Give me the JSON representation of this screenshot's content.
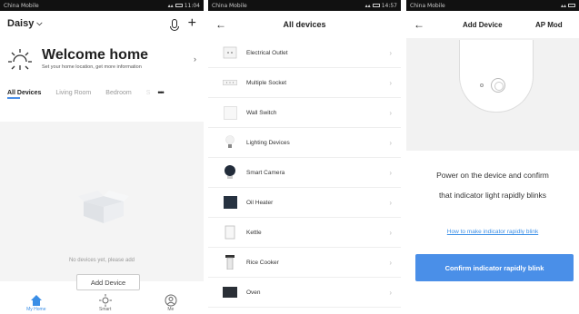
{
  "screen1": {
    "status": {
      "carrier": "China Mobile",
      "time": "11:04"
    },
    "home_name": "Daisy",
    "welcome_title": "Welcome home",
    "welcome_sub": "Set your home location, get more information",
    "tabs": [
      "All Devices",
      "Living Room",
      "Bedroom",
      "S"
    ],
    "empty_text": "No devices yet, please add",
    "add_button": "Add Device",
    "nav": [
      "My Home",
      "Smart",
      "Me"
    ]
  },
  "screen2": {
    "status": {
      "carrier": "China Mobile",
      "time": "14:57"
    },
    "title": "All devices",
    "devices": [
      {
        "label": "Electrical Outlet",
        "icon": "outlet-icon"
      },
      {
        "label": "Multiple Socket",
        "icon": "power-strip-icon"
      },
      {
        "label": "Wall Switch",
        "icon": "wall-switch-icon"
      },
      {
        "label": "Lighting Devices",
        "icon": "bulb-icon"
      },
      {
        "label": "Smart Camera",
        "icon": "camera-icon"
      },
      {
        "label": "Oil Heater",
        "icon": "heater-icon"
      },
      {
        "label": "Kettle",
        "icon": "kettle-icon"
      },
      {
        "label": "Rice Cooker",
        "icon": "rice-cooker-icon"
      },
      {
        "label": "Oven",
        "icon": "oven-icon"
      }
    ]
  },
  "screen3": {
    "status": {
      "carrier": "China Mobile"
    },
    "title": "Add Device",
    "title_mode": "AP Mod",
    "instruction_line1": "Power on the device and confirm",
    "instruction_line2": "that indicator light rapidly blinks",
    "help_link": "How to make indicator rapidly blink",
    "confirm_button": "Confirm indicator rapidly blink"
  }
}
